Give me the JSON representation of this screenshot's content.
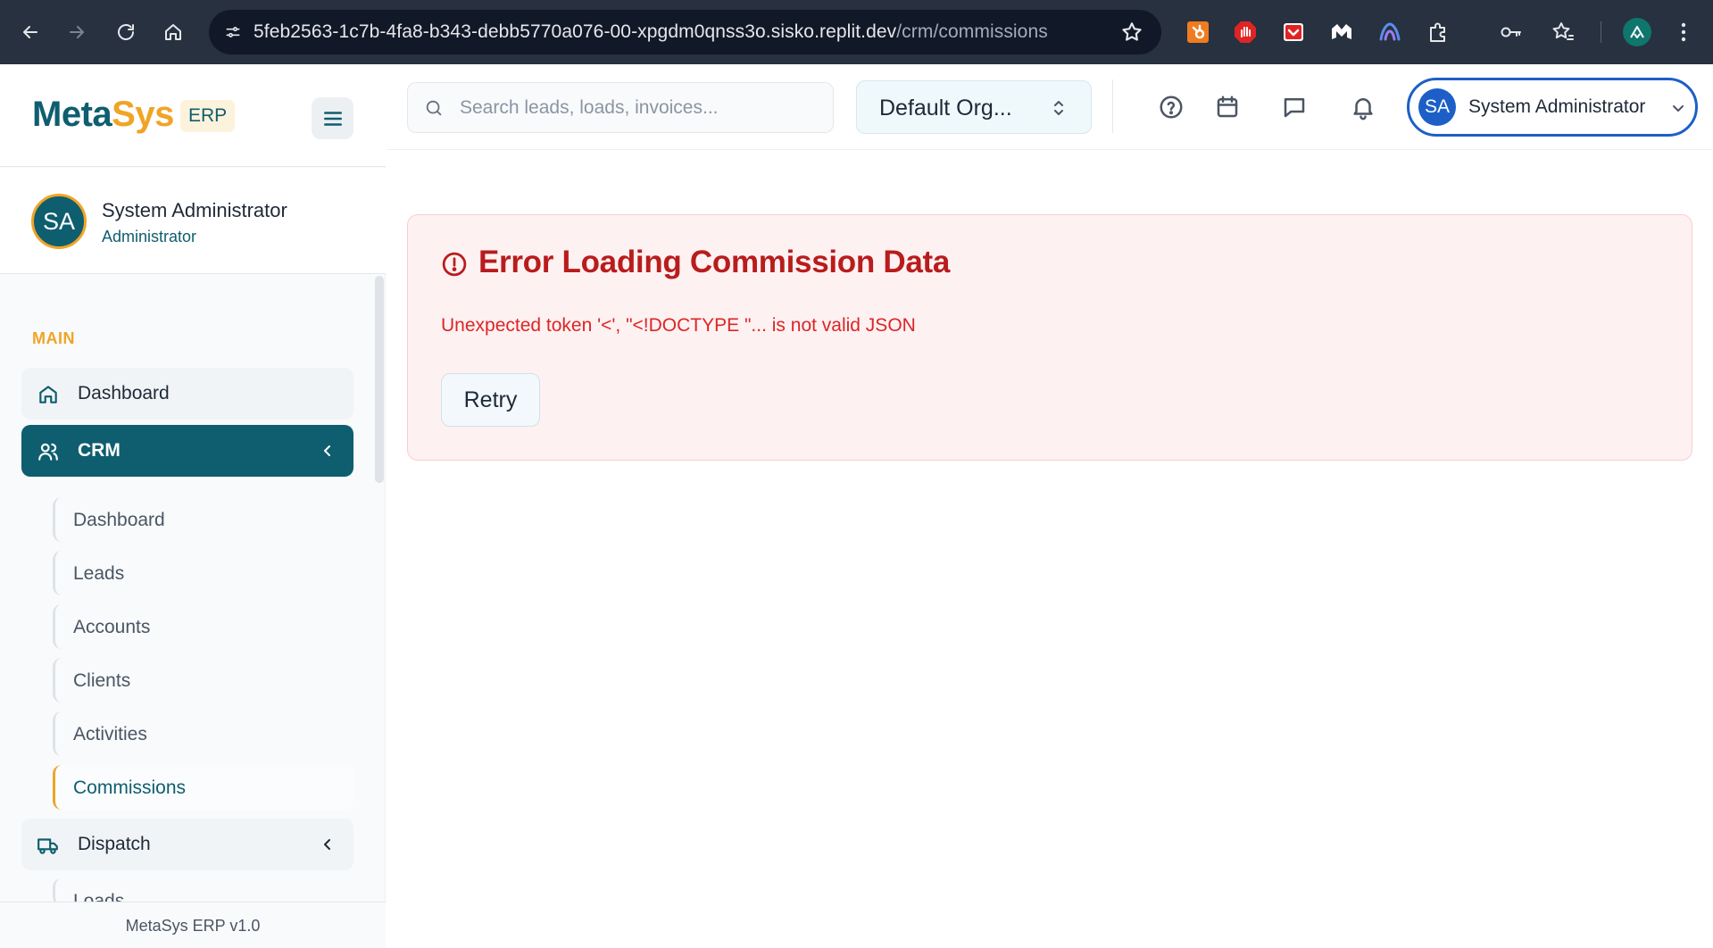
{
  "browser": {
    "url_host": "5feb2563-1c7b-4fa8-b343-debb5770a076-00-xpgdm0qnss3o.sisko.replit.dev",
    "url_path": "/crm/commissions"
  },
  "brand": {
    "name_part1": "Meta",
    "name_part2": "Sys",
    "badge": "ERP"
  },
  "user": {
    "initials": "SA",
    "name": "System Administrator",
    "role": "Administrator"
  },
  "sidebar": {
    "section_main": "MAIN",
    "items": {
      "dashboard": "Dashboard",
      "crm": "CRM",
      "dispatch": "Dispatch"
    },
    "crm_children": [
      "Dashboard",
      "Leads",
      "Accounts",
      "Clients",
      "Activities",
      "Commissions"
    ],
    "dispatch_children": [
      "Loads"
    ],
    "footer": "MetaSys ERP v1.0"
  },
  "topbar": {
    "search_placeholder": "Search leads, loads, invoices...",
    "org": "Default Org...",
    "user_initials": "SA",
    "user_name": "System Administrator"
  },
  "error": {
    "title": "Error Loading Commission Data",
    "message": "Unexpected token '<', \"<!DOCTYPE \"... is not valid JSON",
    "retry_label": "Retry"
  },
  "colors": {
    "brand_primary": "#0e5e6f",
    "brand_accent": "#f0a426",
    "error": "#b91c1c",
    "user_menu_border": "#1d5fc7"
  }
}
